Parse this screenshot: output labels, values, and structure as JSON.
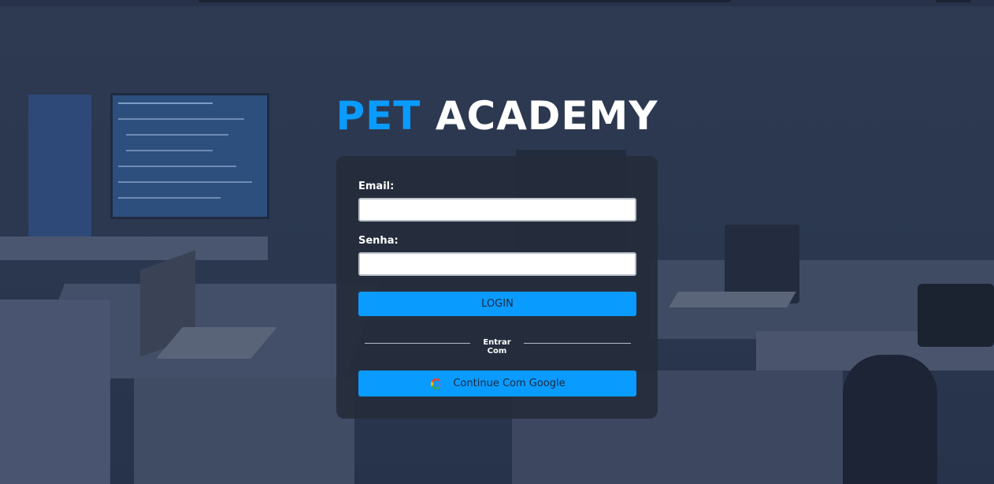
{
  "brand": {
    "title_accent": "PET",
    "title_rest": "ACADEMY",
    "accent_color": "#0a9bff"
  },
  "form": {
    "email_label": "Email:",
    "email_value": "",
    "password_label": "Senha:",
    "password_value": "",
    "login_button": "LOGIN",
    "divider_text": "Entrar Com",
    "google_button": "Continue Com Google",
    "google_icon": "google-g-icon"
  }
}
